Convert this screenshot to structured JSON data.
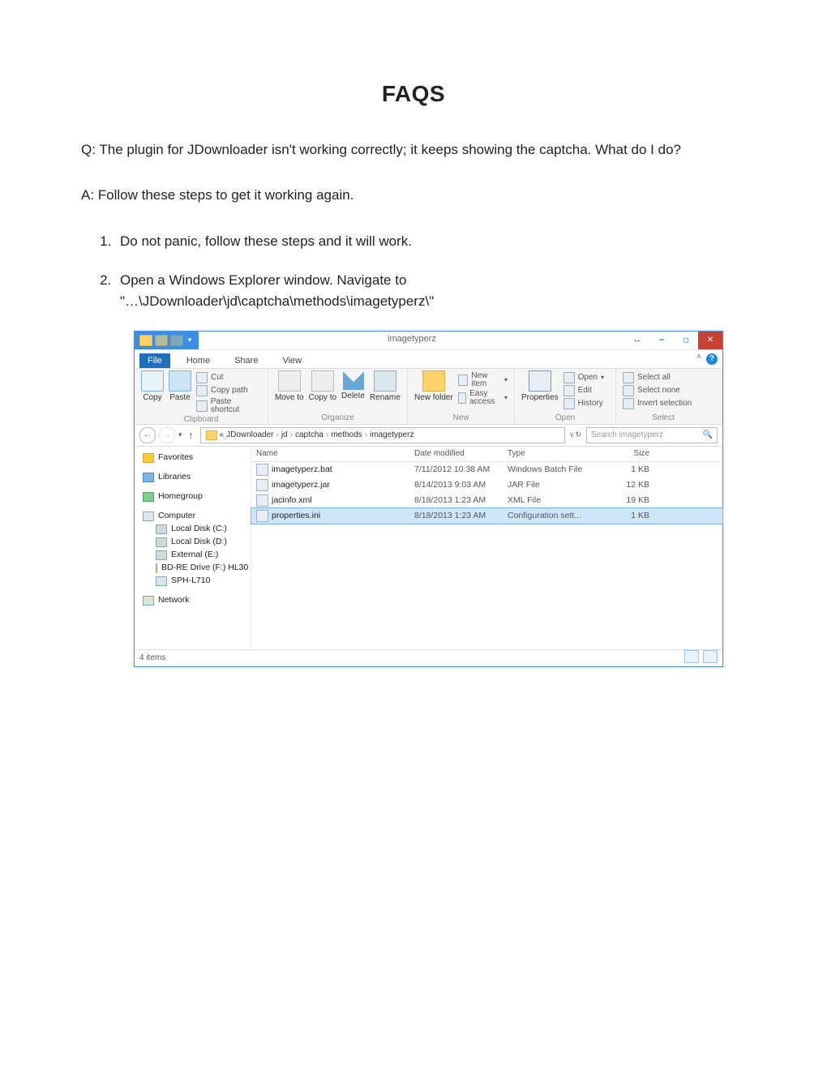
{
  "doc": {
    "title": "FAQS",
    "question": "Q: The plugin for JDownloader isn't working correctly; it keeps showing the captcha. What do I do?",
    "answer_intro": "A: Follow these steps to get it working again.",
    "step1": "Do not panic, follow these steps and it will work.",
    "step2_a": "Open a Windows Explorer window. Navigate to",
    "step2_b": "\"…\\JDownloader\\jd\\captcha\\methods\\imagetyperz\\\""
  },
  "explorer": {
    "window_title": "imagetyperz",
    "tabs": {
      "file": "File",
      "home": "Home",
      "share": "Share",
      "view": "View"
    },
    "ribbon": {
      "clipboard": {
        "copy": "Copy",
        "paste": "Paste",
        "cut": "Cut",
        "copypath": "Copy path",
        "pasteshortcut": "Paste shortcut",
        "label": "Clipboard"
      },
      "organize": {
        "moveto": "Move to",
        "copyto": "Copy to",
        "delete": "Delete",
        "rename": "Rename",
        "label": "Organize"
      },
      "new": {
        "newfolder": "New folder",
        "newitem": "New item",
        "easyaccess": "Easy access",
        "label": "New"
      },
      "open": {
        "properties": "Properties",
        "open": "Open",
        "edit": "Edit",
        "history": "History",
        "label": "Open"
      },
      "select": {
        "all": "Select all",
        "none": "Select none",
        "invert": "Invert selection",
        "label": "Select"
      }
    },
    "breadcrumb": {
      "prefix": "«",
      "parts": [
        "JDownloader",
        "jd",
        "captcha",
        "methods",
        "imagetyperz"
      ]
    },
    "search_placeholder": "Search imagetyperz",
    "columns": {
      "name": "Name",
      "date": "Date modified",
      "type": "Type",
      "size": "Size"
    },
    "files": [
      {
        "name": "imagetyperz.bat",
        "date": "7/11/2012 10:38 AM",
        "type": "Windows Batch File",
        "size": "1 KB"
      },
      {
        "name": "imagetyperz.jar",
        "date": "8/14/2013 9:03 AM",
        "type": "JAR File",
        "size": "12 KB"
      },
      {
        "name": "jacinfo.xml",
        "date": "8/18/2013 1:23 AM",
        "type": "XML File",
        "size": "19 KB"
      },
      {
        "name": "properties.ini",
        "date": "8/18/2013 1:23 AM",
        "type": "Configuration sett...",
        "size": "1 KB"
      }
    ],
    "nav": {
      "favorites": "Favorites",
      "libraries": "Libraries",
      "homegroup": "Homegroup",
      "computer": "Computer",
      "drives": [
        "Local Disk (C:)",
        "Local Disk (D:)",
        "External (E:)",
        "BD-RE Drive (F:) HL30",
        "SPH-L710"
      ],
      "network": "Network"
    },
    "status": "4 items"
  }
}
